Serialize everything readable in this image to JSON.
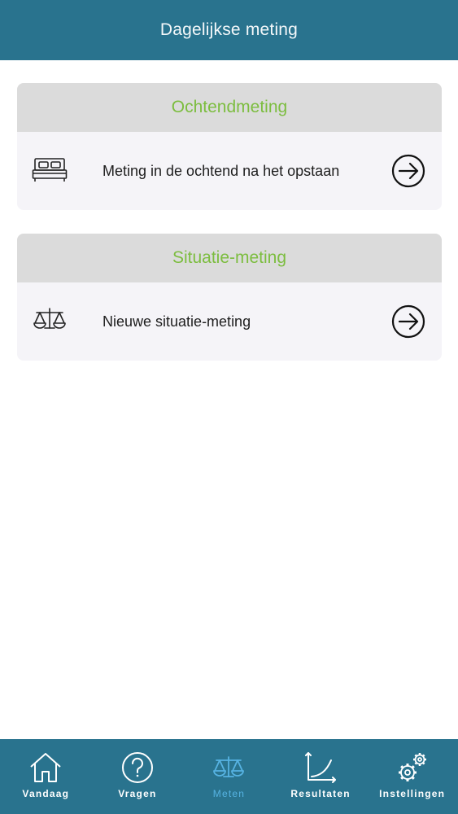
{
  "header": {
    "title": "Dagelijkse meting"
  },
  "sections": [
    {
      "title": "Ochtendmeting",
      "item": {
        "label": "Meting in de ochtend na het opstaan",
        "icon": "bed-icon"
      }
    },
    {
      "title": "Situatie-meting",
      "item": {
        "label": "Nieuwe situatie-meting",
        "icon": "scale-icon"
      }
    }
  ],
  "tabs": [
    {
      "label": "Vandaag",
      "icon": "home-icon"
    },
    {
      "label": "Vragen",
      "icon": "question-icon"
    },
    {
      "label": "Meten",
      "icon": "scale-icon",
      "active": true
    },
    {
      "label": "Resultaten",
      "icon": "chart-icon"
    },
    {
      "label": "Instellingen",
      "icon": "gears-icon"
    }
  ],
  "colors": {
    "primary": "#29738e",
    "section_title": "#7cbd3f",
    "active_tab": "#56b3e2",
    "card_bg": "#f5f4f8",
    "card_header_bg": "#dbdbdb"
  }
}
